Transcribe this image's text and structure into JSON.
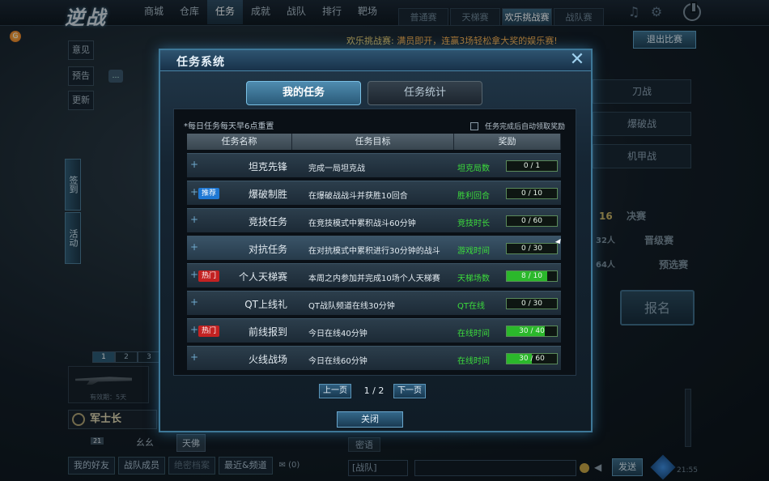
{
  "lobby": {
    "logo": "逆战",
    "nav": [
      "商城",
      "仓库",
      "任务",
      "成就",
      "战队",
      "排行",
      "靶场"
    ],
    "nav_active": 2,
    "modes": [
      "普通赛",
      "天梯赛",
      "欢乐挑战赛",
      "战队赛"
    ],
    "mode_active": 2,
    "event_label": "欢乐挑战赛:",
    "event_text": "满员即开，连赢3场轻松拿大奖的娱乐赛!",
    "exit_button": "退出比赛",
    "side_buttons": [
      "意见",
      "预告",
      "更新"
    ],
    "vertical_tabs": [
      "签到",
      "活动"
    ],
    "weapon_modes": [
      "刀战",
      "爆破战",
      "机甲战"
    ],
    "tiers": [
      "16",
      "决赛",
      "32人",
      "晋级赛",
      "64人",
      "预选赛"
    ],
    "signup_button": "报名",
    "mini_pages": [
      "1",
      "2",
      "3"
    ],
    "weapon_note": "有效期：5天",
    "rank": "军士长",
    "player_level": "21",
    "player_nick": "幺幺",
    "player_nick2": "天佛",
    "bottom_buttons": [
      "我的好友",
      "战队成员",
      "绝密档案",
      "最近&频道"
    ],
    "mail_count": "(0)",
    "chat_tab": "密语",
    "chat_channel": "[战队]",
    "send_button": "发送",
    "clock": "21:55"
  },
  "modal": {
    "title": "任务系统",
    "tabs": [
      "我的任务",
      "任务统计"
    ],
    "note": "*每日任务每天早6点重置",
    "auto_claim": "任务完成后自动领取奖励",
    "headers": [
      "任务名称",
      "任务目标",
      "奖励"
    ],
    "tasks": [
      {
        "tag": "",
        "tag_color": "",
        "name": "坦克先锋",
        "goal": "完成一局坦克战",
        "reward": "坦克局数",
        "progress": "0 / 1",
        "fraction": 0
      },
      {
        "tag": "推荐",
        "tag_color": "blue",
        "name": "爆破制胜",
        "goal": "在爆破战战斗并获胜10回合",
        "reward": "胜利回合",
        "progress": "0 / 10",
        "fraction": 0
      },
      {
        "tag": "",
        "tag_color": "",
        "name": "竞技任务",
        "goal": "在竞技模式中累积战斗60分钟",
        "reward": "竞技时长",
        "progress": "0 / 60",
        "fraction": 0
      },
      {
        "tag": "",
        "tag_color": "",
        "name": "对抗任务",
        "goal": "在对抗模式中累积进行30分钟的战斗",
        "reward": "游戏时间",
        "progress": "0 / 30",
        "fraction": 0
      },
      {
        "tag": "热门",
        "tag_color": "red",
        "name": "个人天梯赛",
        "goal": "本周之内参加并完成10场个人天梯赛",
        "reward": "天梯场数",
        "progress": "8 / 10",
        "fraction": 0.8
      },
      {
        "tag": "",
        "tag_color": "",
        "name": "QT上线礼",
        "goal": "QT战队频道在线30分钟",
        "reward": "QT在线",
        "progress": "0 / 30",
        "fraction": 0
      },
      {
        "tag": "热门",
        "tag_color": "red",
        "name": "前线报到",
        "goal": "今日在线40分钟",
        "reward": "在线时间",
        "progress": "30 / 40",
        "fraction": 0.75
      },
      {
        "tag": "",
        "tag_color": "",
        "name": "火线战场",
        "goal": "今日在线60分钟",
        "reward": "在线时间",
        "progress": "30 / 60",
        "fraction": 0.5
      }
    ],
    "pager": {
      "prev": "上一页",
      "page": "1 / 2",
      "next": "下一页"
    },
    "close_button": "关闭"
  },
  "colors": {
    "accent": "#3e7898",
    "progress_fill": "#2bb82b",
    "reward_text": "#3cdc3c",
    "tag_red": "#c32222",
    "tag_blue": "#1e78d4"
  }
}
